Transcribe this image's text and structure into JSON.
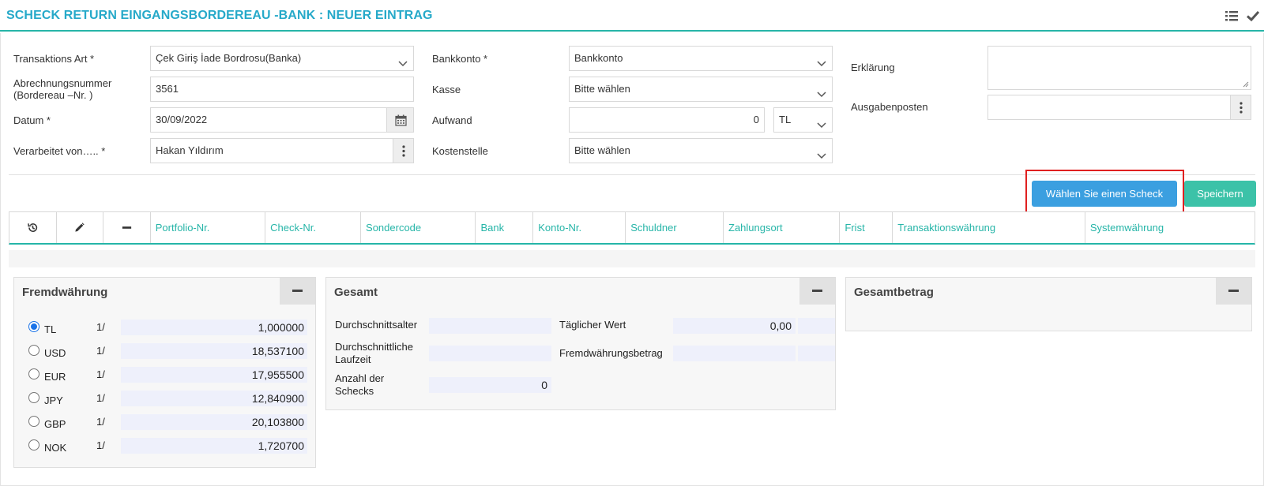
{
  "header": {
    "title": "SCHECK RETURN EINGANGSBORDEREAU -BANK : NEUER EINTRAG",
    "icons": [
      "list-icon",
      "check-icon"
    ]
  },
  "form": {
    "col1": {
      "transaction_type": {
        "label": "Transaktions Art *",
        "value": "Çek Giriş İade Bordrosu(Banka)"
      },
      "settlement_no": {
        "label_line1": "Abrechnungsnummer",
        "label_line2": "(Bordereau –Nr. )",
        "value": "3561"
      },
      "date": {
        "label": "Datum *",
        "value": "30/09/2022"
      },
      "processed_by": {
        "label": "Verarbeitet von….. *",
        "value": "Hakan Yıldırım"
      }
    },
    "col2": {
      "bank_account": {
        "label": "Bankkonto *",
        "value": "Bankkonto"
      },
      "cash": {
        "label": "Kasse",
        "value": "Bitte wählen"
      },
      "expense": {
        "label": "Aufwand",
        "value": "0",
        "currency": "TL"
      },
      "cost_center": {
        "label": "Kostenstelle",
        "value": "Bitte wählen"
      }
    },
    "col3": {
      "explanation": {
        "label": "Erklärung",
        "value": ""
      },
      "expense_item": {
        "label": "Ausgabenposten",
        "value": ""
      }
    }
  },
  "buttons": {
    "select_check": "Wählen Sie einen Scheck",
    "save": "Speichern"
  },
  "grid": {
    "icon_columns": [
      "history-icon",
      "pencil-icon",
      "minus-icon"
    ],
    "columns": [
      "Portfolio-Nr.",
      "Check-Nr.",
      "Sondercode",
      "Bank",
      "Konto-Nr.",
      "Schuldner",
      "Zahlungsort",
      "Frist",
      "Transaktionswährung",
      "Systemwährung"
    ]
  },
  "fx_panel": {
    "title": "Fremdwährung",
    "rows": [
      {
        "code": "TL",
        "div": "1/",
        "rate": "1,000000",
        "selected": true
      },
      {
        "code": "USD",
        "div": "1/",
        "rate": "18,537100",
        "selected": false
      },
      {
        "code": "EUR",
        "div": "1/",
        "rate": "17,955500",
        "selected": false
      },
      {
        "code": "JPY",
        "div": "1/",
        "rate": "12,840900",
        "selected": false
      },
      {
        "code": "GBP",
        "div": "1/",
        "rate": "20,103800",
        "selected": false
      },
      {
        "code": "NOK",
        "div": "1/",
        "rate": "1,720700",
        "selected": false
      }
    ]
  },
  "total_panel": {
    "title": "Gesamt",
    "avg_age": {
      "label": "Durchschnittsalter",
      "value": ""
    },
    "avg_term": {
      "label_line1": "Durchschnittliche",
      "label_line2": "Laufzeit",
      "value": ""
    },
    "num_checks": {
      "label_line1": "Anzahl der",
      "label_line2": "Schecks",
      "value": "0"
    },
    "daily_value": {
      "label": "Täglicher Wert",
      "value": "0,00"
    },
    "fx_amount": {
      "label": "Fremdwährungsbetrag",
      "value": ""
    }
  },
  "grand_panel": {
    "title": "Gesamtbetrag"
  },
  "colors": {
    "accent": "#26b5a8",
    "title": "#26a9c9",
    "primary_button": "#3b9fe0",
    "save_button": "#3cc2a8",
    "highlight": "#e02020"
  }
}
